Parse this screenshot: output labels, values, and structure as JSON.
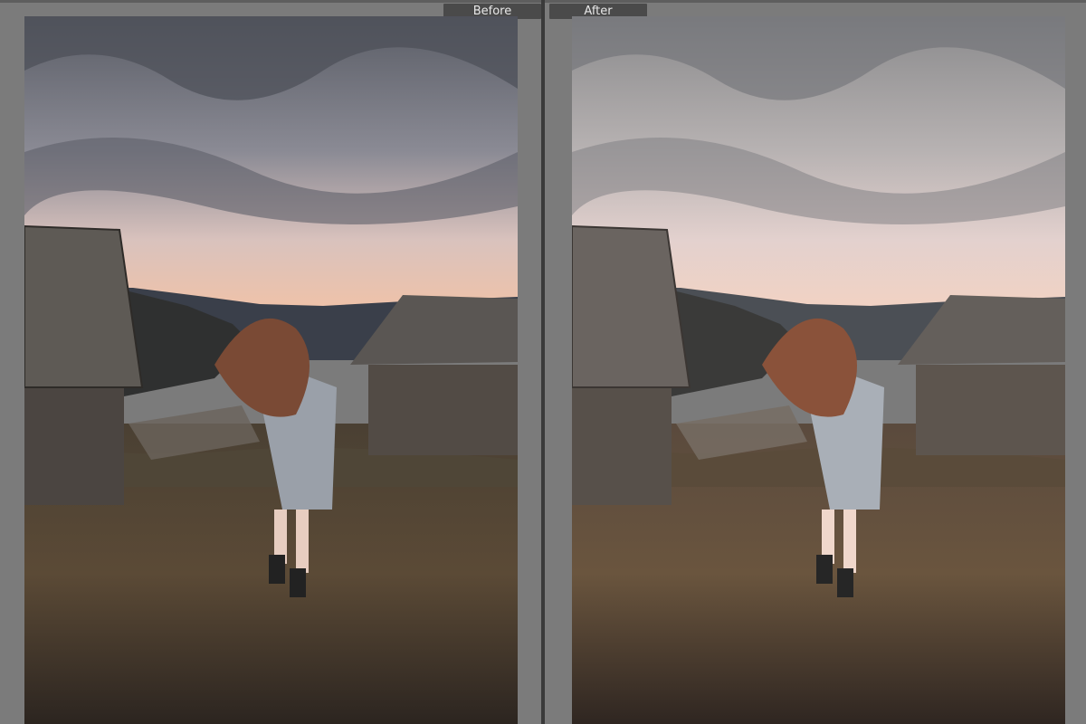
{
  "compare": {
    "before_label": "Before",
    "after_label": "After"
  },
  "panels": [
    {
      "id": "before",
      "scene": "girl-running-mountain-cabins",
      "grade": "original"
    },
    {
      "id": "after",
      "scene": "girl-running-mountain-cabins",
      "grade": "warm-matte"
    }
  ],
  "colors": {
    "background": "#7b7b7b",
    "label_bg": "#4a4a4a",
    "label_text": "#e8e8e8",
    "divider": "#3a3a3a"
  }
}
